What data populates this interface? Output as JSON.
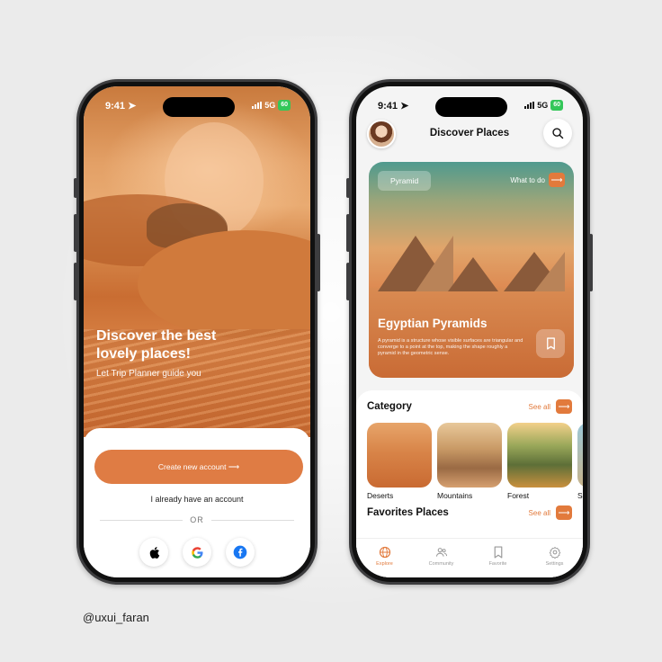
{
  "status_bar": {
    "time": "9:41",
    "network": "5G",
    "battery": "60"
  },
  "onboarding": {
    "hero_title": "Discover the best lovely places!",
    "hero_subtitle": "Let Trip Planner guide you",
    "create_account_label": "Create new account ⟶",
    "login_label": "I already have an account",
    "or_label": "OR",
    "social_buttons": [
      "apple-icon",
      "google-icon",
      "facebook-icon"
    ]
  },
  "discover": {
    "title": "Discover Places",
    "featured": {
      "tag": "Pyramid",
      "what_to_do": "What to do",
      "title": "Egyptian Pyramids",
      "description": "A pyramid is a structure whose visible surfaces are triangular and converge to a point at the top, making the shape roughly a pyramid in the geometric sense."
    },
    "category": {
      "title": "Category",
      "see_all": "See all",
      "items": [
        "Deserts",
        "Mountains",
        "Forest",
        "Se"
      ]
    },
    "favorites": {
      "title": "Favorites Places",
      "see_all": "See all"
    },
    "tabs": [
      {
        "label": "Explore",
        "icon": "globe-icon",
        "active": true
      },
      {
        "label": "Community",
        "icon": "users-icon",
        "active": false
      },
      {
        "label": "Favorite",
        "icon": "bookmark-icon",
        "active": false
      },
      {
        "label": "Settings",
        "icon": "gear-icon",
        "active": false
      }
    ]
  },
  "credit": "@uxui_faran",
  "colors": {
    "accent": "#e27a3c",
    "background": "#ebebeb",
    "frame": "#3d3d3f"
  }
}
